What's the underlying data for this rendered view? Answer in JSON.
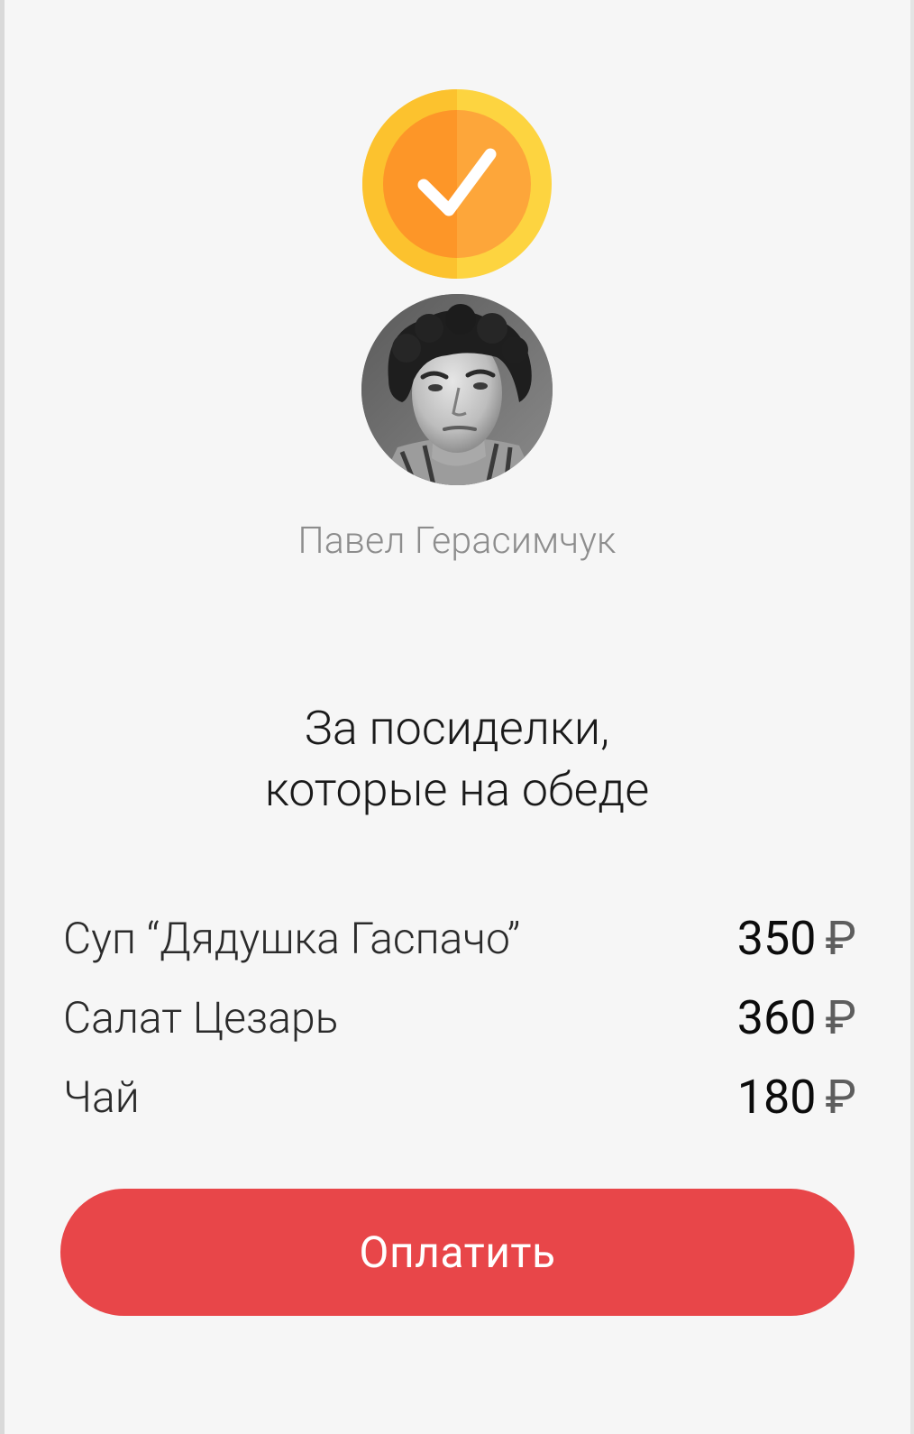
{
  "status": {
    "icon": "checkmark-coin-icon",
    "colors": {
      "outer": "#fdd440",
      "inner": "#fd9b29",
      "check": "#ffffff"
    }
  },
  "recipient": {
    "name": "Павел Герасимчук",
    "avatar_icon": "user-photo"
  },
  "bill": {
    "title_line1": "За посиделки,",
    "title_line2": "которые на обеде",
    "currency_symbol": "₽",
    "items": [
      {
        "name": "Суп “Дядушка Гаспачо”",
        "price": "350"
      },
      {
        "name": "Салат Цезарь",
        "price": "360"
      },
      {
        "name": "Чай",
        "price": "180"
      }
    ]
  },
  "actions": {
    "pay_label": "Оплатить",
    "pay_color": "#e84649"
  }
}
